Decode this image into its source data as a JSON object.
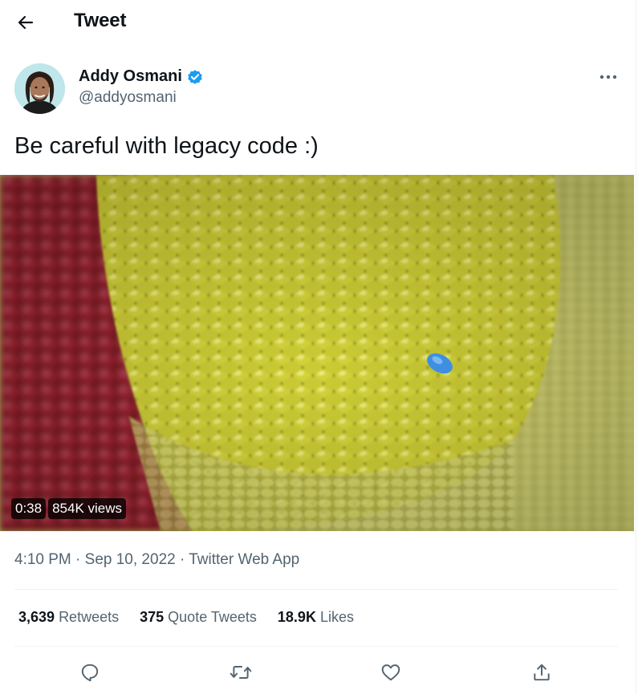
{
  "header": {
    "title": "Tweet",
    "back_icon": "arrow-left-icon"
  },
  "author": {
    "name": "Addy Osmani",
    "handle": "@addyosmani",
    "verified": true
  },
  "tweet": {
    "text": "Be careful with legacy code :)"
  },
  "media": {
    "duration": "0:38",
    "views": "854K views"
  },
  "meta": {
    "time": "4:10 PM",
    "sep1": " · ",
    "date": "Sep 10, 2022",
    "sep2": " · ",
    "source": "Twitter Web App"
  },
  "stats": [
    {
      "count": "3,639",
      "label": "Retweets"
    },
    {
      "count": "375",
      "label": "Quote Tweets"
    },
    {
      "count": "18.9K",
      "label": "Likes"
    }
  ],
  "actions": [
    "reply-icon",
    "retweet-icon",
    "like-icon",
    "share-icon"
  ],
  "colors": {
    "text": "#0f1419",
    "secondary": "#536471",
    "verified": "#1d9bf0",
    "divider": "#eff3f4"
  }
}
